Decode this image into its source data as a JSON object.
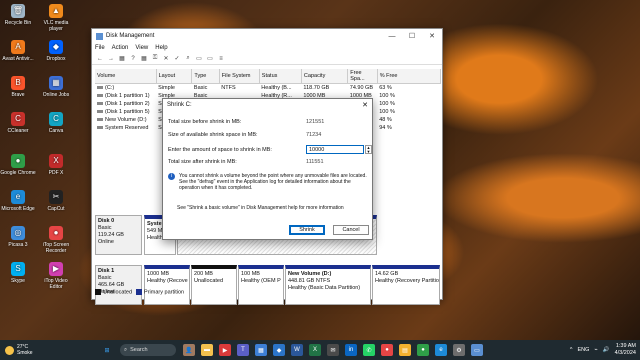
{
  "desktop": {
    "icons": [
      {
        "label": "Recycle Bin",
        "color": "#9fb6c8",
        "glyph": "🗑"
      },
      {
        "label": "VLC media player",
        "color": "#f08a1c",
        "glyph": "▲"
      },
      {
        "label": "Avast Antivir...",
        "color": "#f07a1c",
        "glyph": "A"
      },
      {
        "label": "Dropbox",
        "color": "#0061fe",
        "glyph": "◆"
      },
      {
        "label": "Brave",
        "color": "#fb542b",
        "glyph": "B"
      },
      {
        "label": "Online Jobs",
        "color": "#3d6fd6",
        "glyph": "▦"
      },
      {
        "label": "CCleaner",
        "color": "#c8312b",
        "glyph": "C"
      },
      {
        "label": "Canva",
        "color": "#13a5c4",
        "glyph": "C"
      },
      {
        "label": "Google Chrome",
        "color": "#2f9e48",
        "glyph": "●"
      },
      {
        "label": "PDF X",
        "color": "#c22b2b",
        "glyph": "X"
      },
      {
        "label": "Microsoft Edge",
        "color": "#1d8bd8",
        "glyph": "e"
      },
      {
        "label": "CapCut",
        "color": "#222222",
        "glyph": "✂"
      },
      {
        "label": "Picasa 3",
        "color": "#3e8ddb",
        "glyph": "◎"
      },
      {
        "label": "iTop Screen Recorder",
        "color": "#e64545",
        "glyph": "●"
      },
      {
        "label": "Skype",
        "color": "#00aff0",
        "glyph": "S"
      },
      {
        "label": "iTop Video Editor",
        "color": "#d13fb0",
        "glyph": "▶"
      }
    ]
  },
  "window": {
    "title": "Disk Management",
    "controls": {
      "minimize": "—",
      "maximize": "☐",
      "close": "✕"
    },
    "menu": [
      "File",
      "Action",
      "View",
      "Help"
    ],
    "toolbar_icons": [
      "back-icon",
      "forward-icon",
      "grid-icon",
      "help-icon",
      "grid-icon",
      "key-icon",
      "delete-icon",
      "check-icon",
      "search-icon",
      "folder-icon",
      "folder-icon",
      "list-icon"
    ],
    "table": {
      "headers": [
        "Volume",
        "Layout",
        "Type",
        "File System",
        "Status",
        "Capacity",
        "Free Spa...",
        "% Free"
      ],
      "rows": [
        [
          "(C:)",
          "Simple",
          "Basic",
          "NTFS",
          "Healthy (B...",
          "118.70 GB",
          "74.90 GB",
          "63 %"
        ],
        [
          "(Disk 1 partition 1)",
          "Simple",
          "Basic",
          "",
          "Healthy (R...",
          "1000 MB",
          "1000 MB",
          "100 %"
        ],
        [
          "(Disk 1 partition 2)",
          "Simple",
          "Basic",
          "",
          "Healthy (E...",
          "100 MB",
          "100 MB",
          "100 %"
        ],
        [
          "(Disk 1 partition 5)",
          "Simple",
          "Basic",
          "",
          "Healthy (R...",
          "14.62 GB",
          "14.62 GB",
          "100 %"
        ],
        [
          "New Volume (D:)",
          "Sim",
          "",
          "",
          "",
          "",
          "",
          "48 %"
        ],
        [
          "System Reserved",
          "Sim",
          "",
          "",
          "",
          "",
          "",
          "94 %"
        ]
      ]
    },
    "disks": [
      {
        "name": "Disk 0",
        "type": "Basic",
        "size": "119.24 GB",
        "status": "Online",
        "parts": [
          {
            "title": "System",
            "size": "549 ME",
            "info": "Healthy",
            "kind": "primary"
          },
          {
            "title": "",
            "size": "",
            "info": "",
            "kind": "selected"
          }
        ]
      },
      {
        "name": "Disk 1",
        "type": "Basic",
        "size": "465.64 GB",
        "status": "Online",
        "parts": [
          {
            "title": "",
            "size": "1000 MB",
            "info": "Healthy (Recove",
            "kind": "primary"
          },
          {
            "title": "",
            "size": "200 MB",
            "info": "Unallocated",
            "kind": "unalloc"
          },
          {
            "title": "",
            "size": "100 MB",
            "info": "Healthy (OEM P",
            "kind": "primary"
          },
          {
            "title": "New Volume (D:)",
            "size": "448.81 GB NTFS",
            "info": "Healthy (Basic Data Partition)",
            "kind": "primary"
          },
          {
            "title": "",
            "size": "14.62 GB",
            "info": "Healthy (Recovery Partition)",
            "kind": "primary"
          }
        ]
      }
    ],
    "legend": [
      {
        "label": "Unallocated",
        "color": "#111111"
      },
      {
        "label": "Primary partition",
        "color": "#1b2f8f"
      }
    ]
  },
  "dialog": {
    "title": "Shrink C:",
    "close": "✕",
    "rows": [
      {
        "label": "Total size before shrink in MB:",
        "value": "121551"
      },
      {
        "label": "Size of available shrink space in MB:",
        "value": "71234"
      },
      {
        "label": "Enter the amount of space to shrink in MB:",
        "value": "10000"
      },
      {
        "label": "Total size after shrink in MB:",
        "value": "111551"
      }
    ],
    "info_icon": "i",
    "info_text": "You cannot shrink a volume beyond the point where any unmovable files are located. See the \"defrag\" event in the Application log for detailed information about the operation when it has completed.",
    "help_text": "See \"Shrink a basic volume\" in Disk Management help for more information",
    "shrink_button": "Shrink",
    "cancel_button": "Cancel"
  },
  "taskbar": {
    "weather_temp": "27°C",
    "weather_desc": "Smoke",
    "search_placeholder": "Search",
    "time": "1:39 AM",
    "date": "4/3/2024",
    "tray_symbols": [
      "^",
      "ENG",
      "⌁",
      "🔊"
    ],
    "pinned": [
      {
        "name": "start-icon",
        "color": "#3aa0f0",
        "glyph": "⊞"
      },
      {
        "name": "user-avatar-icon",
        "color": "#a07a60",
        "glyph": "👤"
      },
      {
        "name": "file-explorer-icon",
        "color": "#f2c14e",
        "glyph": "▬"
      },
      {
        "name": "video-app-icon",
        "color": "#d93a3a",
        "glyph": "▶"
      },
      {
        "name": "teams-icon",
        "color": "#5b5fc7",
        "glyph": "T"
      },
      {
        "name": "store-icon",
        "color": "#3d7fd6",
        "glyph": "▦"
      },
      {
        "name": "photos-icon",
        "color": "#2b74c8",
        "glyph": "◆"
      },
      {
        "name": "word-icon",
        "color": "#2b579a",
        "glyph": "W"
      },
      {
        "name": "excel-icon",
        "color": "#217346",
        "glyph": "X"
      },
      {
        "name": "mail-icon",
        "color": "#4a4a4a",
        "glyph": "✉"
      },
      {
        "name": "linkedin-icon",
        "color": "#0a66c2",
        "glyph": "in"
      },
      {
        "name": "whatsapp-icon",
        "color": "#25d366",
        "glyph": "✆"
      },
      {
        "name": "screen-recorder-icon",
        "color": "#e64545",
        "glyph": "●"
      },
      {
        "name": "notes-icon",
        "color": "#f3b12f",
        "glyph": "▤"
      },
      {
        "name": "chrome-icon",
        "color": "#2f9e48",
        "glyph": "●"
      },
      {
        "name": "edge-icon",
        "color": "#1d8bd8",
        "glyph": "e"
      },
      {
        "name": "settings-icon",
        "color": "#6d6d6d",
        "glyph": "⚙"
      },
      {
        "name": "disk-management-icon",
        "color": "#5a8fd1",
        "glyph": "▭"
      }
    ]
  }
}
